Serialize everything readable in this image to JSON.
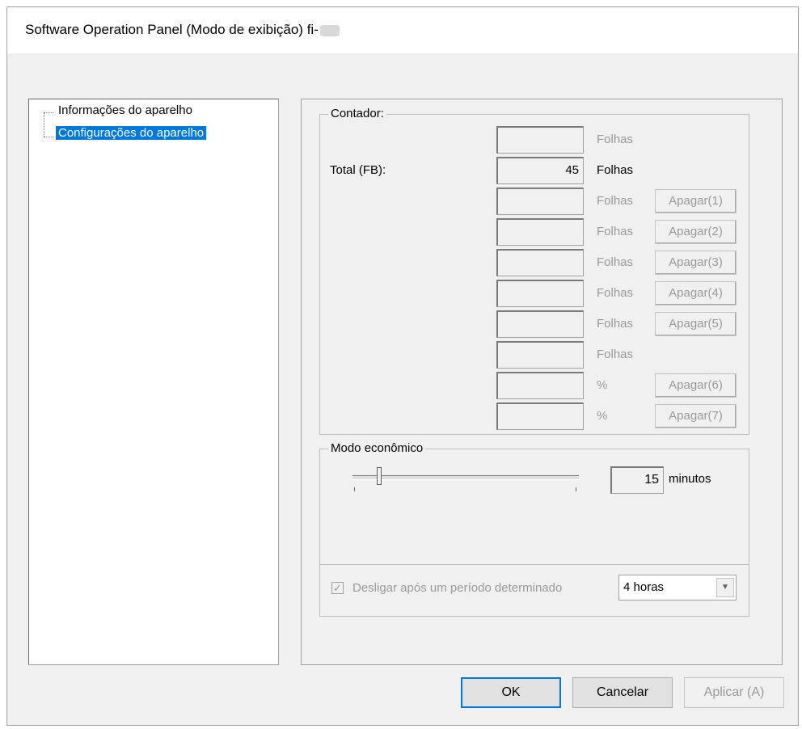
{
  "window": {
    "title": "Software Operation Panel (Modo de exibição) fi-"
  },
  "tree": {
    "items": [
      {
        "label": "Informações do aparelho"
      },
      {
        "label": "Configurações do aparelho",
        "selected": true
      }
    ]
  },
  "counter": {
    "group_label": "Contador:",
    "rows": [
      {
        "label": "",
        "value": "",
        "unit": "Folhas",
        "enabled": false,
        "button": ""
      },
      {
        "label": "Total (FB):",
        "value": "45",
        "unit": "Folhas",
        "enabled": true,
        "button": ""
      },
      {
        "label": "",
        "value": "",
        "unit": "Folhas",
        "enabled": false,
        "button": "Apagar(1)"
      },
      {
        "label": "",
        "value": "",
        "unit": "Folhas",
        "enabled": false,
        "button": "Apagar(2)"
      },
      {
        "label": "",
        "value": "",
        "unit": "Folhas",
        "enabled": false,
        "button": "Apagar(3)"
      },
      {
        "label": "",
        "value": "",
        "unit": "Folhas",
        "enabled": false,
        "button": "Apagar(4)"
      },
      {
        "label": "",
        "value": "",
        "unit": "Folhas",
        "enabled": false,
        "button": "Apagar(5)"
      },
      {
        "label": "",
        "value": "",
        "unit": "Folhas",
        "enabled": false,
        "button": ""
      },
      {
        "label": "",
        "value": "",
        "unit": "%",
        "enabled": false,
        "button": "Apagar(6)"
      },
      {
        "label": "",
        "value": "",
        "unit": "%",
        "enabled": false,
        "button": "Apagar(7)"
      }
    ]
  },
  "eco": {
    "group_label": "Modo econômico",
    "value": "15",
    "unit": "minutos",
    "checkbox_label": "Desligar após um período determinado",
    "checkbox_checked": true,
    "select_value": "4 horas"
  },
  "buttons": {
    "ok": "OK",
    "cancel": "Cancelar",
    "apply": "Aplicar (A)"
  },
  "colors": {
    "selection": "#0078d7",
    "disabled_text": "#9a9a9a"
  }
}
